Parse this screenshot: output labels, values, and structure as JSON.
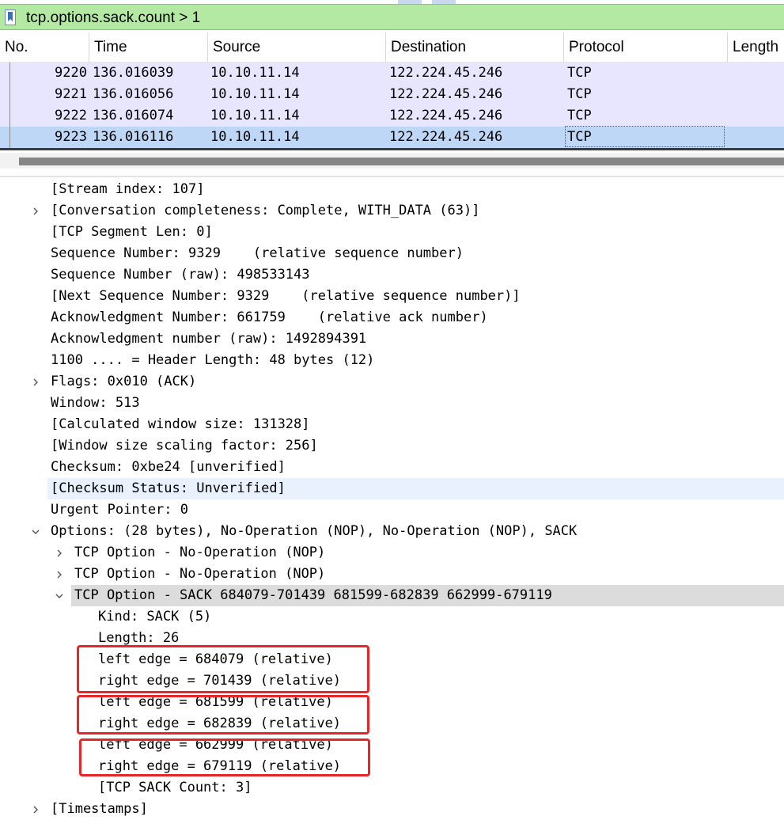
{
  "filter": {
    "expression": "tcp.options.sack.count > 1"
  },
  "columns": [
    "No.",
    "Time",
    "Source",
    "Destination",
    "Protocol",
    "Length"
  ],
  "packets": [
    {
      "no": "9220",
      "time": "136.016039",
      "source": "10.10.11.14",
      "destination": "122.224.45.246",
      "protocol": "TCP",
      "selected": false
    },
    {
      "no": "9221",
      "time": "136.016056",
      "source": "10.10.11.14",
      "destination": "122.224.45.246",
      "protocol": "TCP",
      "selected": false
    },
    {
      "no": "9222",
      "time": "136.016074",
      "source": "10.10.11.14",
      "destination": "122.224.45.246",
      "protocol": "TCP",
      "selected": false
    },
    {
      "no": "9223",
      "time": "136.016116",
      "source": "10.10.11.14",
      "destination": "122.224.45.246",
      "protocol": "TCP",
      "selected": true
    }
  ],
  "details": [
    {
      "text": "[Stream index: 107]"
    },
    {
      "text": "[Conversation completeness: Complete, WITH_DATA (63)]",
      "expander": "collapsed"
    },
    {
      "text": "[TCP Segment Len: 0]"
    },
    {
      "text": "Sequence Number: 9329    (relative sequence number)"
    },
    {
      "text": "Sequence Number (raw): 498533143"
    },
    {
      "text": "[Next Sequence Number: 9329    (relative sequence number)]"
    },
    {
      "text": "Acknowledgment Number: 661759    (relative ack number)"
    },
    {
      "text": "Acknowledgment number (raw): 1492894391"
    },
    {
      "text": "1100 .... = Header Length: 48 bytes (12)"
    },
    {
      "text": "Flags: 0x010 (ACK)",
      "expander": "collapsed"
    },
    {
      "text": "Window: 513"
    },
    {
      "text": "[Calculated window size: 131328]"
    },
    {
      "text": "[Window size scaling factor: 256]"
    },
    {
      "text": "Checksum: 0xbe24 [unverified]"
    },
    {
      "text": "[Checksum Status: Unverified]",
      "highlight": "blue"
    },
    {
      "text": "Urgent Pointer: 0"
    },
    {
      "text": "Options: (28 bytes), No-Operation (NOP), No-Operation (NOP), SACK",
      "expander": "expanded"
    },
    {
      "text": "TCP Option - No-Operation (NOP)",
      "expander": "collapsed",
      "level": 1
    },
    {
      "text": "TCP Option - No-Operation (NOP)",
      "expander": "collapsed",
      "level": 1
    },
    {
      "text": "TCP Option - SACK 684079-701439 681599-682839 662999-679119",
      "expander": "expanded",
      "level": 1,
      "highlight": "gray"
    },
    {
      "text": "Kind: SACK (5)",
      "level": 2
    },
    {
      "text": "Length: 26",
      "level": 2
    },
    {
      "text": "left edge = 684079 (relative)",
      "level": 2
    },
    {
      "text": "right edge = 701439 (relative)",
      "level": 2
    },
    {
      "text": "left edge = 681599 (relative)",
      "level": 2
    },
    {
      "text": "right edge = 682839 (relative)",
      "level": 2
    },
    {
      "text": "left edge = 662999 (relative)",
      "level": 2
    },
    {
      "text": "right edge = 679119 (relative)",
      "level": 2
    },
    {
      "text": "[TCP SACK Count: 3]",
      "level": 2
    },
    {
      "text": "[Timestamps]",
      "expander": "collapsed"
    }
  ],
  "colors": {
    "filter_ok": "#b4e9a3",
    "row_bg": "#e7e6fe",
    "row_selected": "#bfd7f6",
    "annotation_red": "#e8262a"
  },
  "icons": {
    "filter": "bookmark-icon",
    "collapsed": "chevron-right-icon",
    "expanded": "chevron-down-icon"
  }
}
